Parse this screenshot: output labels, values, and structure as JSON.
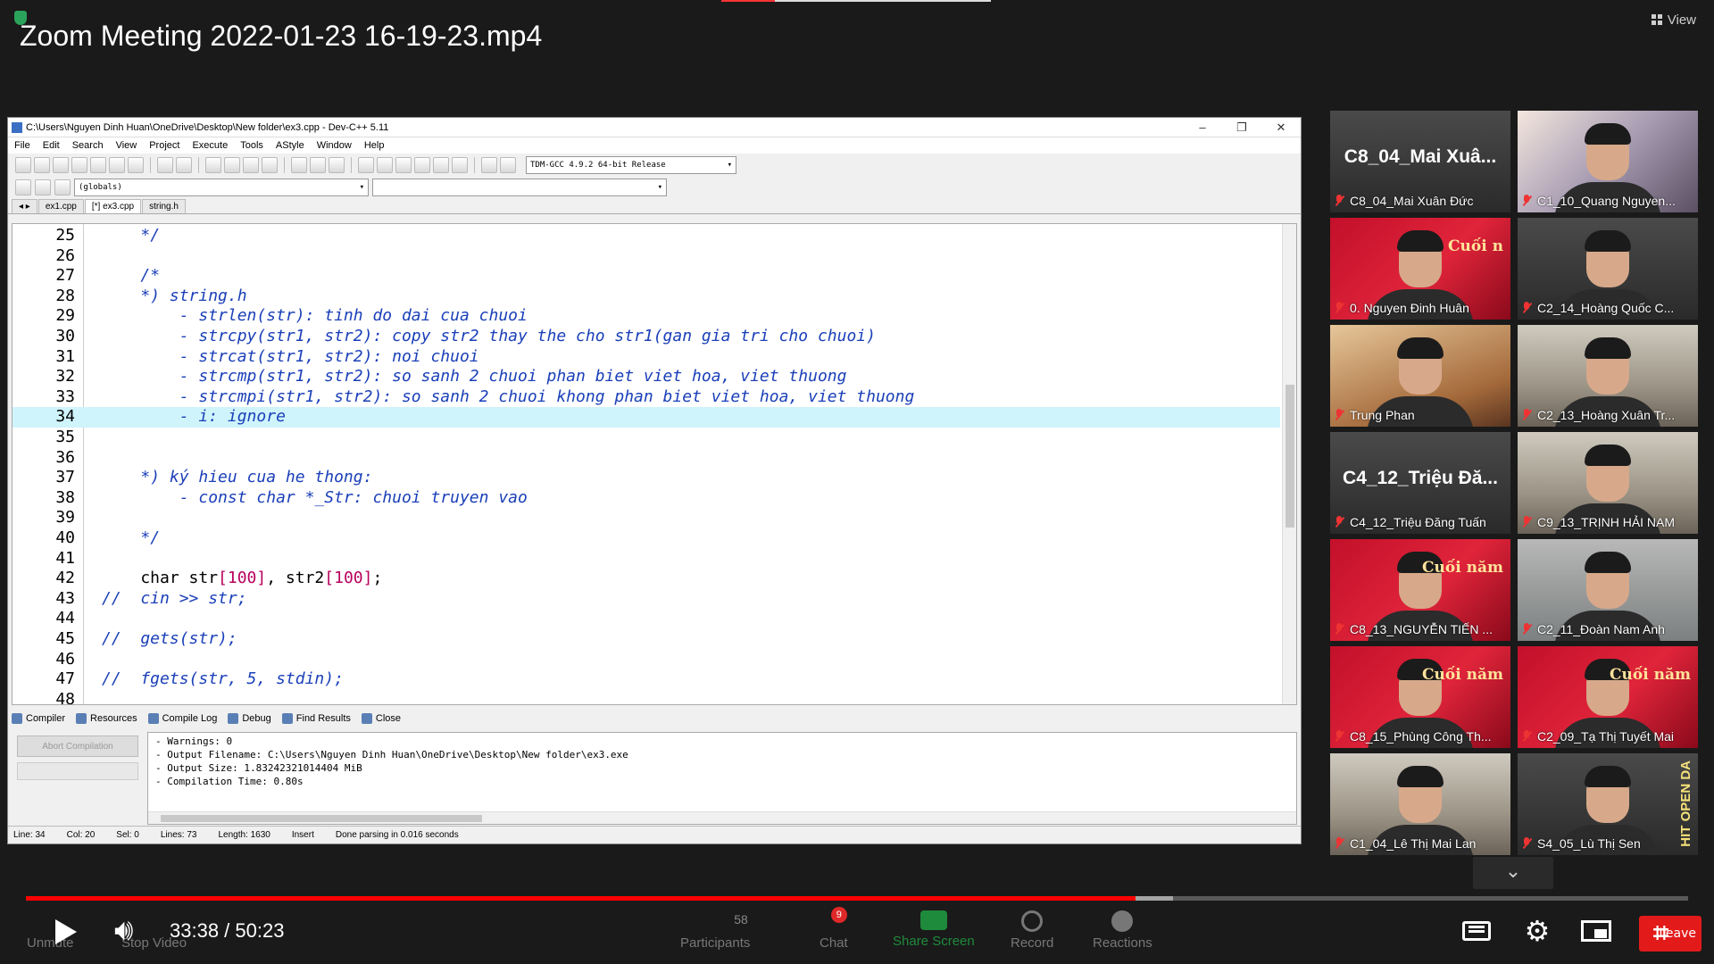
{
  "video": {
    "title": "Zoom Meeting 2022-01-23 16-19-23.mp4",
    "current_time": "33:38",
    "separator": " / ",
    "duration": "50:23",
    "progress_fraction": 0.6676,
    "buffer_fraction": 0.69,
    "accent_color": "#ff0000",
    "view_label": "View"
  },
  "devcpp": {
    "window_title": "C:\\Users\\Nguyen Dinh Huan\\OneDrive\\Desktop\\New folder\\ex3.cpp - Dev-C++ 5.11",
    "menu": [
      "File",
      "Edit",
      "Search",
      "View",
      "Project",
      "Execute",
      "Tools",
      "AStyle",
      "Window",
      "Help"
    ],
    "compiler_select": "TDM-GCC 4.9.2 64-bit Release",
    "globals_select": "(globals)",
    "file_tabs": [
      "ex1.cpp",
      "[*] ex3.cpp",
      "string.h"
    ],
    "active_tab_index": 1,
    "code_lines": [
      {
        "n": "25",
        "html": "    <span class='cm'>*/</span>"
      },
      {
        "n": "26",
        "html": ""
      },
      {
        "n": "27",
        "html": "    <span class='cm'>/*</span>"
      },
      {
        "n": "28",
        "html": "    <span class='cm'>*) string.h</span>"
      },
      {
        "n": "29",
        "html": "        <span class='cm'>- strlen(str): tinh do dai cua chuoi</span>"
      },
      {
        "n": "30",
        "html": "        <span class='cm'>- strcpy(str1, str2): copy str2 thay the cho str1(gan gia tri cho chuoi)</span>"
      },
      {
        "n": "31",
        "html": "        <span class='cm'>- strcat(str1, str2): noi chuoi</span>"
      },
      {
        "n": "32",
        "html": "        <span class='cm'>- strcmp(str1, str2): so sanh 2 chuoi phan biet viet hoa, viet thuong</span>"
      },
      {
        "n": "33",
        "html": "        <span class='cm'>- strcmpi(str1, str2): so sanh 2 chuoi khong phan biet viet hoa, viet thuong</span>"
      },
      {
        "n": "34",
        "html": "        <span class='cm'>- i: ignore</span>",
        "highlight": true
      },
      {
        "n": "35",
        "html": ""
      },
      {
        "n": "36",
        "html": ""
      },
      {
        "n": "37",
        "html": "    <span class='cm'>*) ký hieu cua he thong:</span>"
      },
      {
        "n": "38",
        "html": "        <span class='cm'>- const char *_Str: chuoi truyen vao</span>"
      },
      {
        "n": "39",
        "html": ""
      },
      {
        "n": "40",
        "html": "    <span class='cm'>*/</span>"
      },
      {
        "n": "41",
        "html": ""
      },
      {
        "n": "42",
        "html": "    char str<span class='num'>[100]</span>, str2<span class='num'>[100]</span>;"
      },
      {
        "n": "43",
        "html": "<span class='cm'>//  cin >> str;</span>"
      },
      {
        "n": "44",
        "html": ""
      },
      {
        "n": "45",
        "html": "<span class='cm'>//  gets(str);</span>"
      },
      {
        "n": "46",
        "html": ""
      },
      {
        "n": "47",
        "html": "<span class='cm'>//  fgets(str, 5, stdin);</span>"
      },
      {
        "n": "48",
        "html": ""
      }
    ],
    "bottom_tabs": [
      "Compiler",
      "Resources",
      "Compile Log",
      "Debug",
      "Find Results",
      "Close"
    ],
    "abort_label": "Abort Compilation",
    "log_lines": [
      "- Warnings: 0",
      "- Output Filename: C:\\Users\\Nguyen Dinh Huan\\OneDrive\\Desktop\\New folder\\ex3.exe",
      "- Output Size: 1.83242321014404 MiB",
      "- Compilation Time: 0.80s"
    ],
    "status": {
      "line": "Line:   34",
      "col": "Col:   20",
      "sel": "Sel:   0",
      "lines": "Lines:   73",
      "length": "Length:  1630",
      "mode": "Insert",
      "message": "Done parsing in 0.016 seconds"
    }
  },
  "participants": [
    {
      "label": "C8_04_Mai Xuân Đức",
      "big": "C8_04_Mai  Xuâ...",
      "style": "photo-dark",
      "video": false
    },
    {
      "label": "C1_10_Quang Nguyen...",
      "style": "photo-anime",
      "video": true
    },
    {
      "label": "0. Nguyen Đinh Huân",
      "style": "photo-red",
      "video": true,
      "active": true,
      "banner": "Cuối n"
    },
    {
      "label": "C2_14_Hoàng Quốc C...",
      "style": "photo-dark",
      "video": true
    },
    {
      "label": "Trung Phan",
      "style": "photo-warm",
      "video": true
    },
    {
      "label": "C2_13_Hoàng Xuân Tr...",
      "style": "photo-room",
      "video": true
    },
    {
      "label": "C4_12_Triệu Đăng Tuấn",
      "big": "C4_12_Triệu  Đă...",
      "style": "photo-dark",
      "video": false
    },
    {
      "label": "C9_13_TRỊNH HẢI NAM",
      "style": "photo-room",
      "video": true
    },
    {
      "label": "C8_13_NGUYỄN TIẾN ...",
      "style": "photo-red",
      "video": true,
      "banner": "Cuối năm"
    },
    {
      "label": "C2_11_Đoàn Nam Anh",
      "style": "photo-gray",
      "video": true
    },
    {
      "label": "C8_15_Phùng Công Th...",
      "style": "photo-red",
      "video": true,
      "banner": "Cuối năm"
    },
    {
      "label": "C2_09_Tạ Thị Tuyết Mai",
      "style": "photo-red",
      "video": true,
      "banner": "Cuối năm"
    },
    {
      "label": "C1_04_Lê Thị Mai Lan",
      "style": "photo-room",
      "video": true
    },
    {
      "label": "S4_05_Lù Thị Sen",
      "style": "photo-dark",
      "video": true,
      "side": "HIT OPEN DA"
    }
  ],
  "zoom_controls": {
    "unmute": "Unmute",
    "stop_video": "Stop Video",
    "participants": "Participants",
    "participants_count": "58",
    "chat": "Chat",
    "chat_badge": "9",
    "share_screen": "Share Screen",
    "record": "Record",
    "reactions": "Reactions",
    "leave": "Leave"
  }
}
